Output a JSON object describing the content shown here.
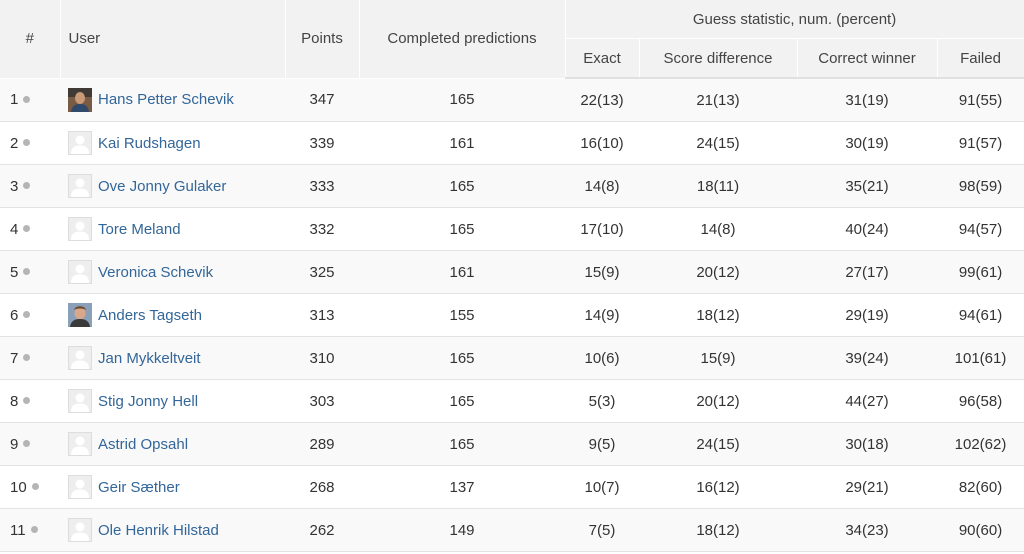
{
  "headers": {
    "rank": "#",
    "user": "User",
    "points": "Points",
    "completed": "Completed predictions",
    "guess_group": "Guess statistic, num. (percent)",
    "exact": "Exact",
    "score_diff": "Score difference",
    "correct_winner": "Correct winner",
    "failed": "Failed"
  },
  "rows": [
    {
      "rank": "1",
      "name": "Hans Petter Schevik",
      "avatar": "photo-1",
      "points": "347",
      "completed": "165",
      "exact": "22(13)",
      "score_diff": "21(13)",
      "correct_winner": "31(19)",
      "failed": "91(55)"
    },
    {
      "rank": "2",
      "name": "Kai Rudshagen",
      "avatar": "default-user-icon",
      "points": "339",
      "completed": "161",
      "exact": "16(10)",
      "score_diff": "24(15)",
      "correct_winner": "30(19)",
      "failed": "91(57)"
    },
    {
      "rank": "3",
      "name": "Ove Jonny Gulaker",
      "avatar": "default-user-icon",
      "points": "333",
      "completed": "165",
      "exact": "14(8)",
      "score_diff": "18(11)",
      "correct_winner": "35(21)",
      "failed": "98(59)"
    },
    {
      "rank": "4",
      "name": "Tore Meland",
      "avatar": "default-user-icon",
      "points": "332",
      "completed": "165",
      "exact": "17(10)",
      "score_diff": "14(8)",
      "correct_winner": "40(24)",
      "failed": "94(57)"
    },
    {
      "rank": "5",
      "name": "Veronica Schevik",
      "avatar": "default-user-icon",
      "points": "325",
      "completed": "161",
      "exact": "15(9)",
      "score_diff": "20(12)",
      "correct_winner": "27(17)",
      "failed": "99(61)"
    },
    {
      "rank": "6",
      "name": "Anders Tagseth",
      "avatar": "photo-2",
      "points": "313",
      "completed": "155",
      "exact": "14(9)",
      "score_diff": "18(12)",
      "correct_winner": "29(19)",
      "failed": "94(61)"
    },
    {
      "rank": "7",
      "name": "Jan Mykkeltveit",
      "avatar": "default-user-icon",
      "points": "310",
      "completed": "165",
      "exact": "10(6)",
      "score_diff": "15(9)",
      "correct_winner": "39(24)",
      "failed": "101(61)"
    },
    {
      "rank": "8",
      "name": "Stig Jonny Hell",
      "avatar": "default-user-icon",
      "points": "303",
      "completed": "165",
      "exact": "5(3)",
      "score_diff": "20(12)",
      "correct_winner": "44(27)",
      "failed": "96(58)"
    },
    {
      "rank": "9",
      "name": "Astrid Opsahl",
      "avatar": "default-user-icon",
      "points": "289",
      "completed": "165",
      "exact": "9(5)",
      "score_diff": "24(15)",
      "correct_winner": "30(18)",
      "failed": "102(62)"
    },
    {
      "rank": "10",
      "name": "Geir Sæther",
      "avatar": "default-user-icon",
      "points": "268",
      "completed": "137",
      "exact": "10(7)",
      "score_diff": "16(12)",
      "correct_winner": "29(21)",
      "failed": "82(60)"
    },
    {
      "rank": "11",
      "name": "Ole Henrik Hilstad",
      "avatar": "default-user-icon",
      "points": "262",
      "completed": "149",
      "exact": "7(5)",
      "score_diff": "18(12)",
      "correct_winner": "34(23)",
      "failed": "90(60)"
    }
  ],
  "colors": {
    "link": "#336699",
    "header_bg": "#f2f2f2",
    "row_stripe": "#f9f9f9",
    "status_dot": "#b5b5b5"
  }
}
